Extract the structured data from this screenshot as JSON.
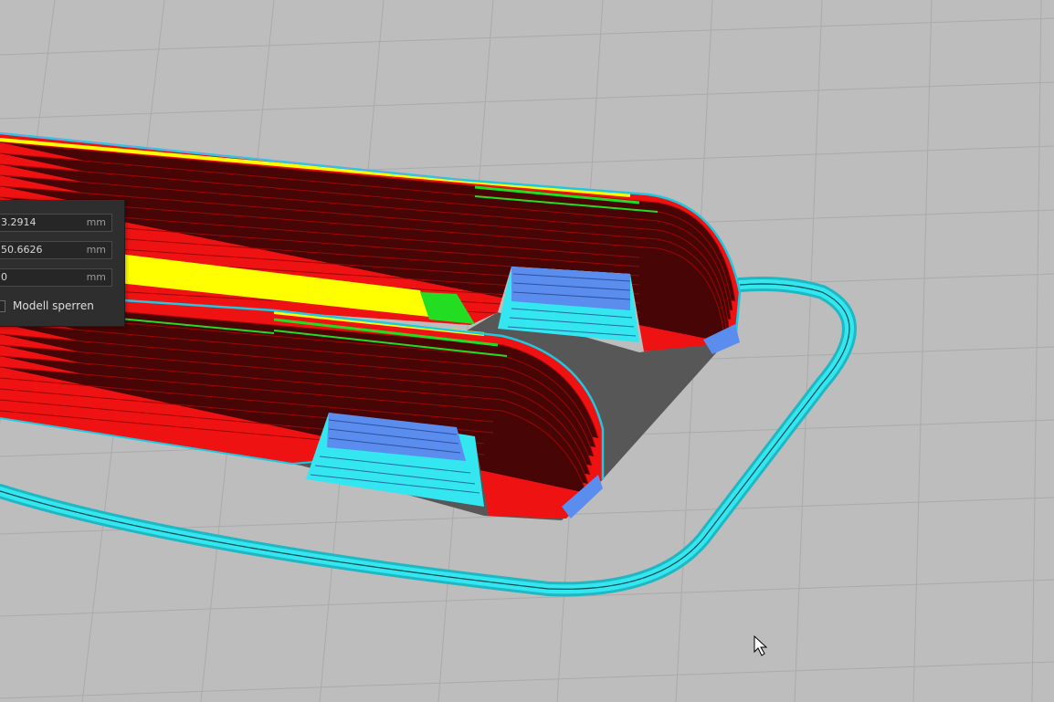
{
  "panel": {
    "fields": [
      {
        "value": "3.2914",
        "unit": "mm"
      },
      {
        "value": "50.6626",
        "unit": "mm"
      },
      {
        "value": "0",
        "unit": "mm"
      }
    ],
    "lock_label": "Modell sperren",
    "lock_checked": false
  },
  "colors": {
    "build_plate": "#bdbdbd",
    "grid_line": "#a9a9a9",
    "wall_outer": "#ff1a1a",
    "infill": "#ffff00",
    "top_bottom": "#22dd22",
    "support": "#5b8dee",
    "skirt": "#33e6ef",
    "panel_bg": "#2e2e2e"
  }
}
